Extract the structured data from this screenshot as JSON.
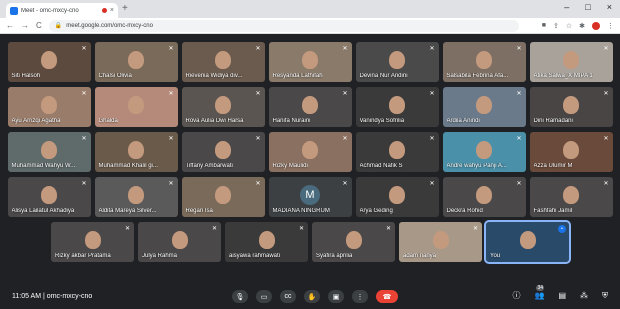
{
  "browser": {
    "tab_title": "Meet - omc-mxcy-cno",
    "tab_close": "×",
    "new_tab": "+",
    "window_controls": [
      "–",
      "□",
      "×"
    ],
    "url": "meet.google.com/omc-mxcy-cno",
    "nav": [
      "←",
      "→",
      "C"
    ]
  },
  "participants": [
    {
      "name": "Siti Halsoh",
      "tone": "#5d4a3f"
    },
    {
      "name": "Chalsi Olivia",
      "tone": "#7a6a5a"
    },
    {
      "name": "Rievenia Widiya div...",
      "tone": "#6b5b4e"
    },
    {
      "name": "Resyanda Lathifah",
      "tone": "#8a7a6a"
    },
    {
      "name": "Devina Nur Andini",
      "tone": "#4a4a4a"
    },
    {
      "name": "Salsabila Febrina Afa...",
      "tone": "#7d6f63"
    },
    {
      "name": "Atika Salwa_X MIPA 1",
      "tone": "#a8a29a"
    },
    {
      "name": "Ayu Arrizqi Agatha",
      "tone": "#9a7c6a"
    },
    {
      "name": "Ghalda",
      "tone": "#b58a7a"
    },
    {
      "name": "Rova Aulia Dwi Harsa",
      "tone": "#5a5550"
    },
    {
      "name": "Hanifa Nuraini",
      "tone": "#4a4848"
    },
    {
      "name": "Vanindya Sofrilia",
      "tone": "#3a3a3a"
    },
    {
      "name": "Ardila Anindi",
      "tone": "#6a7a8a"
    },
    {
      "name": "Dini Ramadani",
      "tone": "#4a4545"
    },
    {
      "name": "Muhammad Wahyu W...",
      "tone": "#5f6a6a"
    },
    {
      "name": "Muhammad Khalil gi...",
      "tone": "#6a5a4a"
    },
    {
      "name": "Tiffany Ambarwati",
      "tone": "#4a4848"
    },
    {
      "name": "Rizky Maulidi",
      "tone": "#8a7060"
    },
    {
      "name": "Achmad Nafik S",
      "tone": "#3a3a3a"
    },
    {
      "name": "Andre wahyu Panji A...",
      "tone": "#4a90a8"
    },
    {
      "name": "Azza Ulumir M",
      "tone": "#6a4a3a"
    },
    {
      "name": "Alisya Lailatul Akhadiya",
      "tone": "#4a4848"
    },
    {
      "name": "Aldita Mareya Silver...",
      "tone": "#5a5a5a"
    },
    {
      "name": "Regan Isa",
      "tone": "#7a6a5a"
    },
    {
      "name": "MADIANA NINGRUM",
      "tone": "#3c4043",
      "initial": "M"
    },
    {
      "name": "Arya Geding",
      "tone": "#3a3a3a"
    },
    {
      "name": "Deckra Rohid",
      "tone": "#4a4848"
    },
    {
      "name": "Fashfahi Jamil",
      "tone": "#4a4848"
    },
    {
      "name": "Rizky akbar Pratama",
      "tone": "#4a4848"
    },
    {
      "name": "Julya Rahma",
      "tone": "#4a4848"
    },
    {
      "name": "aisyawa rahmawati",
      "tone": "#3a3a3a"
    },
    {
      "name": "Syafira aprilia",
      "tone": "#4a4848"
    },
    {
      "name": "adam rianya",
      "tone": "#a89888"
    },
    {
      "name": "You",
      "tone": "#2a4a6a",
      "self": true
    }
  ],
  "bottom": {
    "time": "11:05 AM",
    "separator": "|",
    "meeting_code": "omc-mxcy-cno",
    "people_count": "34"
  },
  "colors": {
    "accent": "#1a73e8",
    "end_call": "#ea4335",
    "stage_bg": "#202124"
  }
}
